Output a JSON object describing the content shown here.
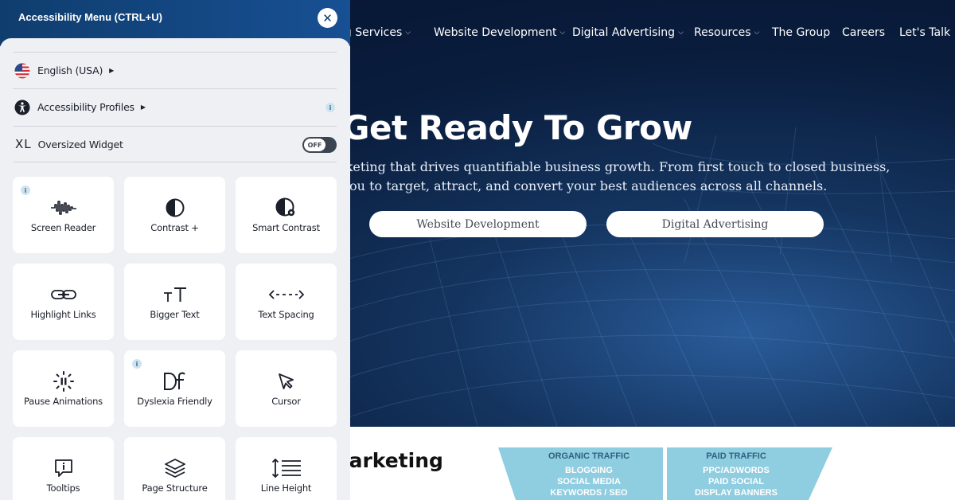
{
  "site": {
    "nav": [
      {
        "label": "ng Services",
        "has_dropdown": true
      },
      {
        "label": "Website Development",
        "has_dropdown": true
      },
      {
        "label": "Digital Advertising",
        "has_dropdown": true
      },
      {
        "label": "Resources",
        "has_dropdown": true
      },
      {
        "label": "The Group",
        "has_dropdown": false
      },
      {
        "label": "Careers",
        "has_dropdown": false
      },
      {
        "label": "Let's Talk",
        "has_dropdown": false
      }
    ],
    "hero": {
      "title": "Get Ready To Grow",
      "subtitle_line1": "rketing that drives quantifiable business growth. From first touch to closed business,",
      "subtitle_line2": "you to target, attract, and convert your best audiences across all channels.",
      "buttons": [
        "Website Development",
        "Digital Advertising"
      ]
    },
    "section": {
      "title": "larketing"
    },
    "funnel": [
      {
        "heading": "ORGANIC TRAFFIC",
        "items": [
          "BLOGGING",
          "SOCIAL MEDIA",
          "KEYWORDS / SEO"
        ]
      },
      {
        "heading": "PAID TRAFFIC",
        "items": [
          "PPC/ADWORDS",
          "PAID SOCIAL",
          "DISPLAY BANNERS"
        ]
      }
    ]
  },
  "accessibility": {
    "title": "Accessibility Menu (CTRL+U)",
    "close_symbol": "✕",
    "language": {
      "label": "English (USA)",
      "icon": "us-flag-icon"
    },
    "profiles": {
      "label": "Accessibility Profiles",
      "info": "i"
    },
    "oversized": {
      "xl": "XL",
      "label": "Oversized Widget",
      "toggle": "OFF"
    },
    "tiles": [
      {
        "label": "Screen Reader",
        "icon": "sound-wave-icon",
        "info": "i"
      },
      {
        "label": "Contrast +",
        "icon": "contrast-icon",
        "info": ""
      },
      {
        "label": "Smart Contrast",
        "icon": "smart-contrast-icon",
        "info": ""
      },
      {
        "label": "Highlight Links",
        "icon": "link-icon",
        "info": ""
      },
      {
        "label": "Bigger Text",
        "icon": "text-size-icon",
        "info": ""
      },
      {
        "label": "Text Spacing",
        "icon": "text-spacing-icon",
        "info": ""
      },
      {
        "label": "Pause Animations",
        "icon": "pause-icon",
        "info": ""
      },
      {
        "label": "Dyslexia Friendly",
        "icon": "dyslexia-icon",
        "info": "i"
      },
      {
        "label": "Cursor",
        "icon": "cursor-icon",
        "info": ""
      },
      {
        "label": "Tooltips",
        "icon": "tooltip-icon",
        "info": ""
      },
      {
        "label": "Page Structure",
        "icon": "layers-icon",
        "info": ""
      },
      {
        "label": "Line Height",
        "icon": "line-height-icon",
        "info": ""
      }
    ],
    "colors": {
      "header": "#0f3d6e",
      "panel": "#eef0f4",
      "tile": "#ffffff",
      "toggle": "#3c4452"
    }
  }
}
